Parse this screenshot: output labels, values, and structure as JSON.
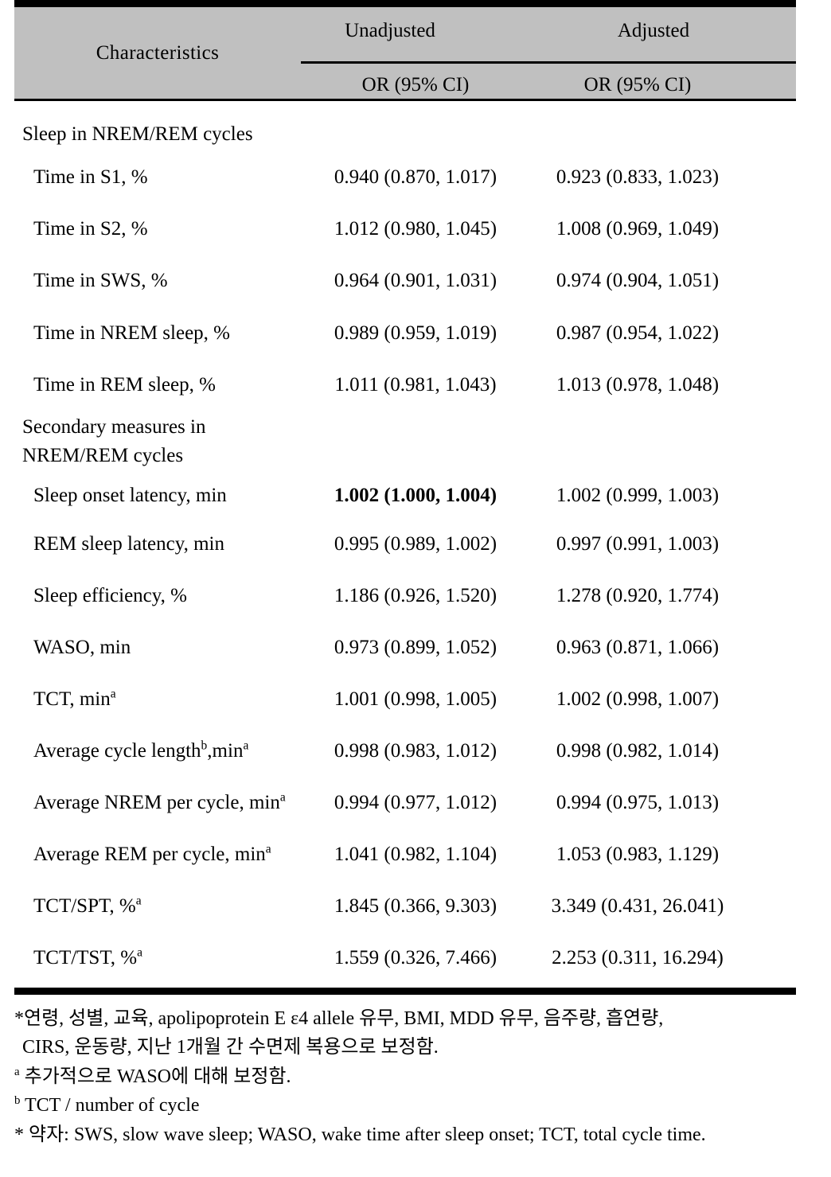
{
  "table": {
    "header": {
      "characteristics": "Characteristics",
      "spanner_unadjusted": "Unadjusted",
      "spanner_adjusted": "Adjusted",
      "sub_unadjusted": "OR (95% CI)",
      "sub_adjusted": "OR (95% CI)"
    },
    "rows": [
      {
        "type": "section",
        "label": "Sleep in NREM/REM    cycles",
        "unadjusted": "",
        "adjusted": ""
      },
      {
        "type": "item",
        "label": "Time in S1, %",
        "unadjusted": "0.940 (0.870, 1.017)",
        "adjusted": "0.923 (0.833, 1.023)"
      },
      {
        "type": "item",
        "label": "Time in S2, %",
        "unadjusted": "1.012 (0.980, 1.045)",
        "adjusted": "1.008 (0.969, 1.049)"
      },
      {
        "type": "item",
        "label": "Time in SWS, %",
        "unadjusted": "0.964 (0.901, 1.031)",
        "adjusted": "0.974 (0.904, 1.051)"
      },
      {
        "type": "item",
        "label": "Time in NREM sleep, %",
        "unadjusted": "0.989 (0.959, 1.019)",
        "adjusted": "0.987 (0.954, 1.022)"
      },
      {
        "type": "item",
        "label": "Time in REM sleep, %",
        "unadjusted": "1.011 (0.981, 1.043)",
        "adjusted": "1.013 (0.978, 1.048)"
      },
      {
        "type": "section2",
        "label_line1": "Secondary measures in",
        "label_line2": "NREM/REM cycles",
        "unadjusted": "",
        "adjusted": ""
      },
      {
        "type": "item",
        "label": "Sleep onset latency, min",
        "unadjusted": "1.002 (1.000, 1.004)",
        "unadjusted_bold": true,
        "adjusted": "1.002 (0.999, 1.003)"
      },
      {
        "type": "item",
        "label": "REM sleep latency, min",
        "unadjusted": "0.995 (0.989, 1.002)",
        "adjusted": "0.997 (0.991, 1.003)"
      },
      {
        "type": "item",
        "label": "Sleep efficiency, %",
        "unadjusted": "1.186 (0.926, 1.520)",
        "adjusted": "1.278 (0.920, 1.774)"
      },
      {
        "type": "item",
        "label": "WASO, min",
        "unadjusted": "0.973 (0.899, 1.052)",
        "adjusted": "0.963 (0.871, 1.066)"
      },
      {
        "type": "item_sup",
        "label_main": "TCT, min",
        "label_sup": "a",
        "unadjusted": "1.001 (0.998, 1.005)",
        "adjusted": "1.002 (0.998, 1.007)"
      },
      {
        "type": "item_sup2",
        "label_main": "Average cycle length",
        "label_sup": "b",
        "label_mid": ",min",
        "label_sup2": "a",
        "unadjusted": "0.998 (0.983, 1.012)",
        "adjusted": "0.998 (0.982, 1.014)"
      },
      {
        "type": "item_sup",
        "label_main": "Average NREM per cycle, min",
        "label_sup": "a",
        "unadjusted": "0.994 (0.977, 1.012)",
        "adjusted": "0.994 (0.975, 1.013)"
      },
      {
        "type": "item_sup",
        "label_main": "Average REM per cycle, min",
        "label_sup": "a",
        "unadjusted": "1.041 (0.982, 1.104)",
        "adjusted": "1.053 (0.983, 1.129)"
      },
      {
        "type": "item_sup",
        "label_main": "TCT/SPT, %",
        "label_sup": "a",
        "unadjusted": "1.845 (0.366, 9.303)",
        "adjusted": "3.349 (0.431, 26.041)"
      },
      {
        "type": "item_sup",
        "label_main": "TCT/TST, %",
        "label_sup": "a",
        "unadjusted": "1.559 (0.326, 7.466)",
        "adjusted": "2.253 (0.311, 16.294)"
      }
    ]
  },
  "footnotes": {
    "line1": "*연령, 성별, 교육, apolipoprotein E  ε4 allele 유무, BMI, MDD 유무, 음주량, 흡연량,",
    "line2": "CIRS, 운동량, 지난 1개월 간 수면제 복용으로 보정함.",
    "marker_a": "a",
    "line3": "추가적으로 WASO에 대해 보정함.",
    "marker_b": "b",
    "line4": "TCT / number of cycle",
    "line5": "* 약자: SWS, slow wave sleep; WASO, wake time after sleep onset; TCT, total cycle time."
  }
}
